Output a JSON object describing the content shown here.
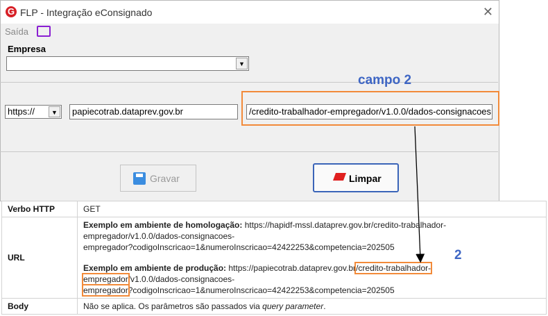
{
  "window": {
    "title": "FLP - Integração eConsignado",
    "app_icon": "G",
    "close_glyph": "✕"
  },
  "menu": {
    "saida": "Saída"
  },
  "empresa": {
    "label": "Empresa",
    "value": ""
  },
  "form": {
    "protocol": "https://",
    "host": "papiecotrab.dataprev.gov.br",
    "path": "/credito-trabalhador-empregador/v1.0.0/dados-consignacoes"
  },
  "buttons": {
    "gravar": "Gravar",
    "limpar": "Limpar"
  },
  "annotations": {
    "campo": "campo 2",
    "number": "2",
    "accent": "#f28a39",
    "label_color": "#3e66c4"
  },
  "table": {
    "verbo_header": "Verbo HTTP",
    "verbo_value": "GET",
    "url_header": "URL",
    "homolog_label": "Exemplo em ambiente de homologação:",
    "homolog_line1": " https://hapidf-mssl.dataprev.gov.br/credito-trabalhador-",
    "homolog_line2": "empregador/v1.0.0/dados-consignacoes-",
    "homolog_line3": "empregador?codigoInscricao=1&numeroInscricao=42422253&competencia=202505",
    "prod_label": "Exemplo em ambiente de produção:",
    "prod_line1_a": " https://papiecotrab.dataprev.gov.br",
    "prod_line1_b": "/credito-trabalhador-",
    "prod_line2_a": "empregador",
    "prod_line2_b": "/v1.0.0/dados-consignacoes-",
    "prod_line3_a": "empregador",
    "prod_line3_b": "?codigoInscricao=1&numeroInscricao=42422253&competencia=202505",
    "body_header": "Body",
    "body_value_a": "Não se aplica. Os parâmetros são passados via ",
    "body_value_b": "query parameter",
    "body_value_c": "."
  }
}
